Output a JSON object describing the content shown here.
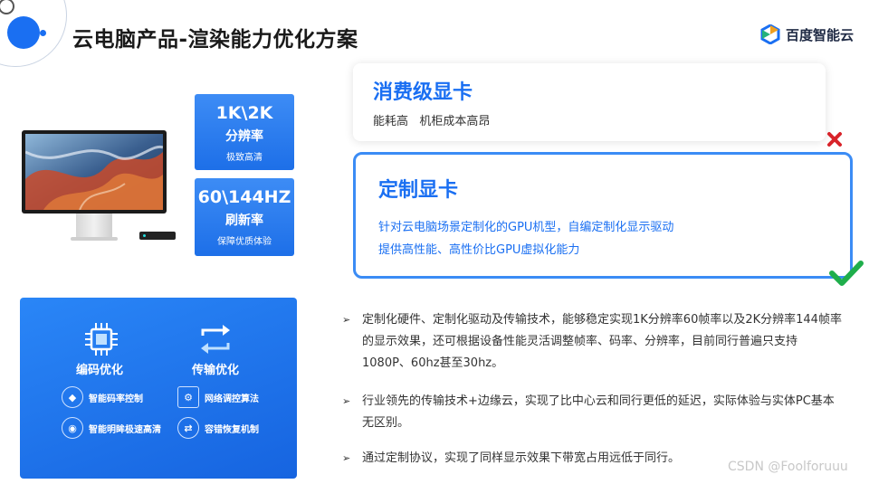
{
  "header": {
    "title": "云电脑产品-渲染能力优化方案",
    "logo_text": "百度智能云"
  },
  "specs": [
    {
      "big": "1K\\2K",
      "mid": "分辨率",
      "small": "极致高清"
    },
    {
      "big": "60\\144HZ",
      "mid": "刷新率",
      "small": "保障优质体验"
    }
  ],
  "features": {
    "encode": {
      "label": "编码优化",
      "items": [
        "智能码率控制",
        "智能明眸极速高清"
      ]
    },
    "transfer": {
      "label": "传输优化",
      "items": [
        "网络调控算法",
        "容错恢复机制"
      ]
    }
  },
  "cards": {
    "consumer": {
      "title": "消费级显卡",
      "desc": "能耗高   机柜成本高昂"
    },
    "custom": {
      "title": "定制显卡",
      "line1": "针对云电脑场景定制化的GPU机型，自编定制化显示驱动",
      "line2": "提供高性能、高性价比GPU虚拟化能力"
    }
  },
  "bullets": [
    "定制化硬件、定制化驱动及传输技术，能够稳定实现1K分辨率60帧率以及2K分辨率144帧率的显示效果，还可根据设备性能灵活调整帧率、码率、分辨率，目前同行普遍只支持1080P、60hz甚至30hz。",
    "行业领先的传输技术+边缘云，实现了比中心云和同行更低的延迟，实际体验与实体PC基本无区别。",
    "通过定制协议，实现了同样显示效果下带宽占用远低于同行。"
  ],
  "watermark": "CSDN @Foolforuuu",
  "colors": {
    "accent": "#1a6ff2",
    "reject": "#d8232a",
    "accept": "#1fae4b"
  }
}
